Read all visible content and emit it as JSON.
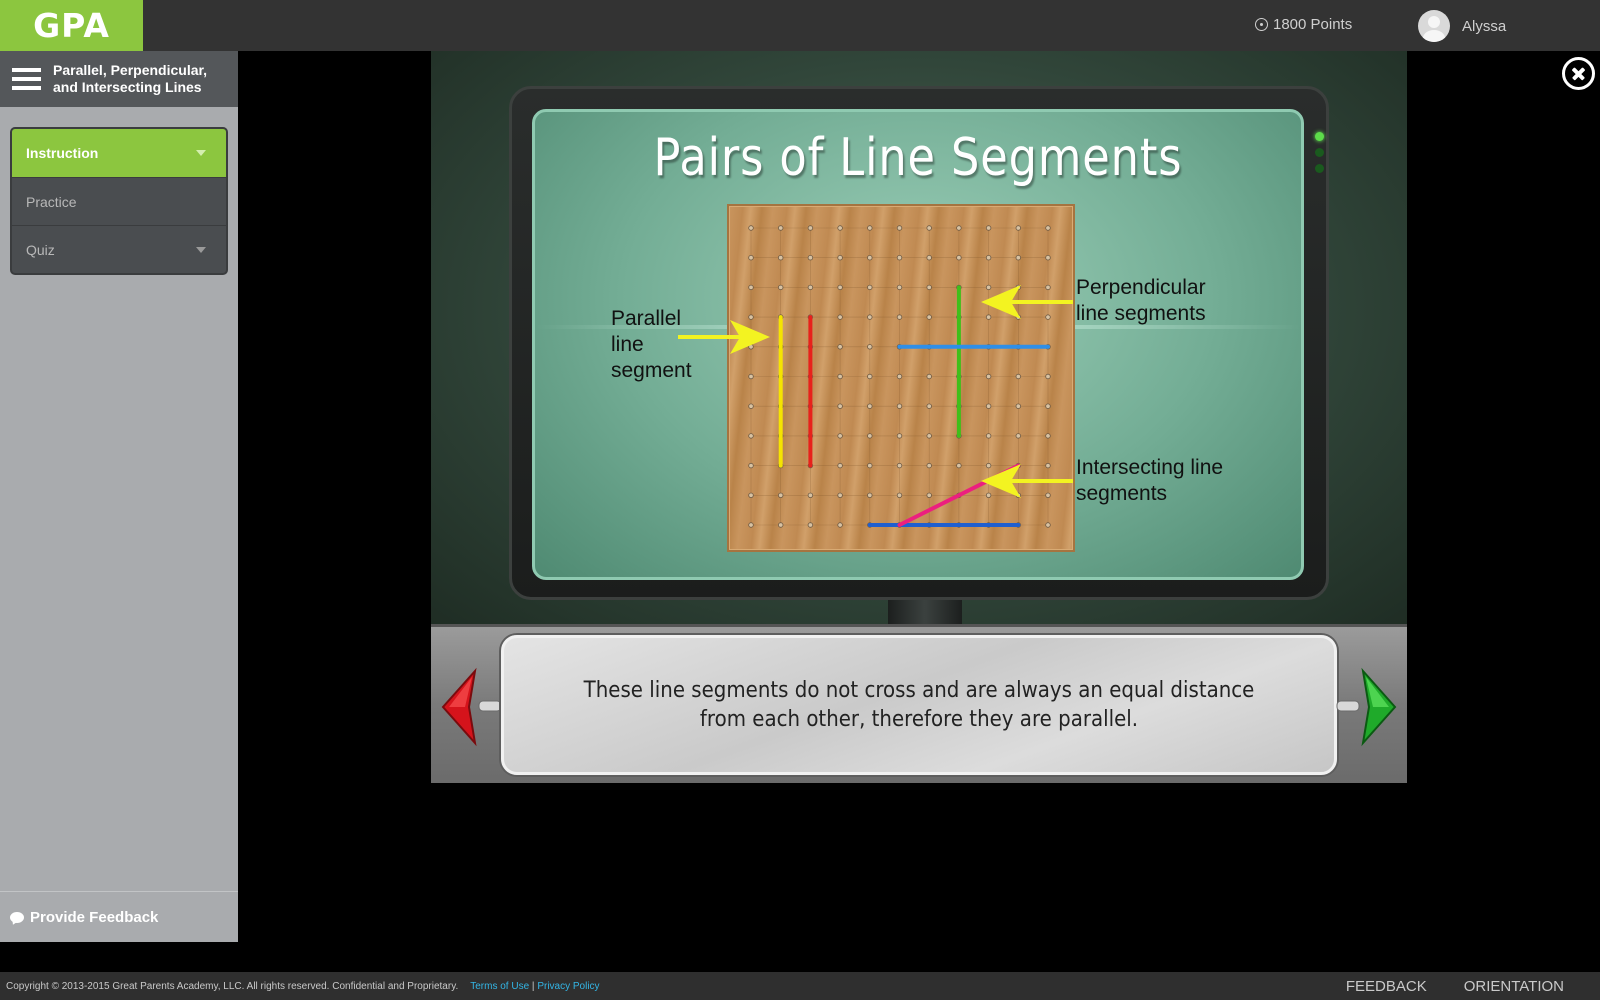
{
  "header": {
    "logo": "GPA",
    "points": "1800 Points",
    "user_name": "Alyssa"
  },
  "sidebar": {
    "lesson_title": "Parallel, Perpendicular, and Intersecting Lines",
    "menu": [
      {
        "label": "Instruction",
        "active": true
      },
      {
        "label": "Practice",
        "active": false
      },
      {
        "label": "Quiz",
        "active": false
      }
    ],
    "feedback_label": "Provide Feedback"
  },
  "slide": {
    "title": "Pairs of Line Segments",
    "labels": {
      "parallel": "Parallel line segment",
      "perpendicular": "Perpendicular line segments",
      "intersecting": "Intersecting line segments"
    },
    "segment_colors": {
      "parallel_a": "#f5e400",
      "parallel_b": "#e8211b",
      "perpendicular_vertical": "#3fbf1a",
      "perpendicular_horizontal": "#2f8fe8",
      "intersecting_diagonal": "#ec1f7f",
      "intersecting_horizontal": "#1f5fd0",
      "arrow": "#f3f321"
    }
  },
  "caption": {
    "text": "These line segments do not cross and are always an equal distance from each other, therefore they are parallel."
  },
  "footer": {
    "copyright": "Copyright © 2013-2015 Great Parents Academy, LLC. All rights reserved. Confidential and Proprietary.",
    "terms": "Terms of Use",
    "separator": "|",
    "privacy": "Privacy Policy",
    "feedback": "FEEDBACK",
    "orientation": "ORIENTATION"
  }
}
